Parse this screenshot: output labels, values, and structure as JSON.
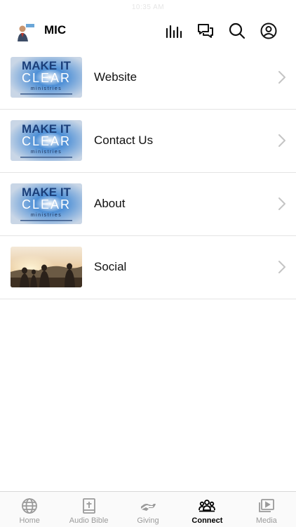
{
  "status_bar": {
    "time": "10:35 AM"
  },
  "header": {
    "title": "MIC",
    "icons": [
      "audio-bars-icon",
      "chat-bubbles-icon",
      "search-icon",
      "profile-icon"
    ]
  },
  "list": [
    {
      "label": "Website",
      "thumbnail": "make-it-clear-ministries-banner"
    },
    {
      "label": "Contact Us",
      "thumbnail": "make-it-clear-ministries-banner"
    },
    {
      "label": "About",
      "thumbnail": "make-it-clear-ministries-banner"
    },
    {
      "label": "Social",
      "thumbnail": "people-sunset-photo"
    }
  ],
  "thumbnail_text": {
    "line1": "MAKE IT",
    "line2": "CLEAR",
    "line3": "ministries"
  },
  "tabs": [
    {
      "label": "Home",
      "icon": "globe-icon",
      "active": false
    },
    {
      "label": "Audio Bible",
      "icon": "bible-icon",
      "active": false
    },
    {
      "label": "Giving",
      "icon": "giving-hand-icon",
      "active": false
    },
    {
      "label": "Connect",
      "icon": "people-group-icon",
      "active": true
    },
    {
      "label": "Media",
      "icon": "media-play-icon",
      "active": false
    }
  ],
  "colors": {
    "active_tab": "#000000",
    "inactive_tab": "#9a9a9a",
    "divider": "#e4e4e4"
  }
}
